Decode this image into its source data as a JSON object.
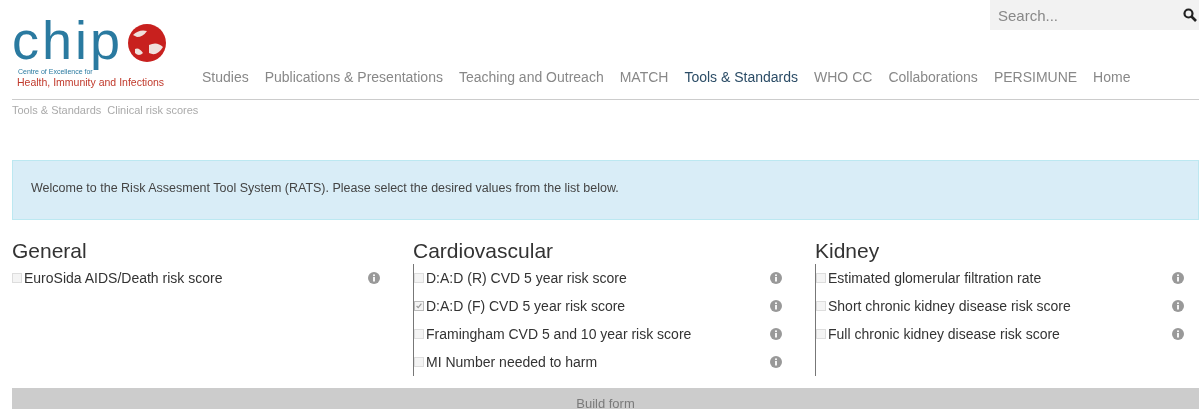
{
  "logo": {
    "wordmark": "chip",
    "tagline": "Centre of Excellence for",
    "subtitle": "Health, Immunity and Infections"
  },
  "search": {
    "placeholder": "Search..."
  },
  "nav": [
    {
      "label": "Studies",
      "selected": false
    },
    {
      "label": "Publications & Presentations",
      "selected": false
    },
    {
      "label": "Teaching and Outreach",
      "selected": false
    },
    {
      "label": "MATCH",
      "selected": false
    },
    {
      "label": "Tools & Standards",
      "selected": true
    },
    {
      "label": "WHO CC",
      "selected": false
    },
    {
      "label": "Collaborations",
      "selected": false
    },
    {
      "label": "PERSIMUNE",
      "selected": false
    },
    {
      "label": "Home",
      "selected": false
    }
  ],
  "breadcrumb": [
    "Tools & Standards",
    "Clinical risk scores"
  ],
  "notice": "Welcome to the Risk Assesment Tool System (RATS). Please select the desired values from the list below.",
  "groups": [
    {
      "title": "General",
      "bordered": false,
      "items": [
        {
          "label": "EuroSida AIDS/Death risk score",
          "checked": false
        }
      ]
    },
    {
      "title": "Cardiovascular",
      "bordered": true,
      "items": [
        {
          "label": "D:A:D (R) CVD 5 year risk score",
          "checked": false
        },
        {
          "label": "D:A:D (F) CVD 5 year risk score",
          "checked": true
        },
        {
          "label": "Framingham CVD 5 and 10 year risk score",
          "checked": false
        },
        {
          "label": "MI Number needed to harm",
          "checked": false
        }
      ]
    },
    {
      "title": "Kidney",
      "bordered": true,
      "items": [
        {
          "label": "Estimated glomerular filtration rate",
          "checked": false
        },
        {
          "label": "Short chronic kidney disease risk score",
          "checked": false
        },
        {
          "label": "Full chronic kidney disease risk score",
          "checked": false
        }
      ]
    }
  ],
  "build_button": {
    "label": "Build form",
    "disabled": true
  }
}
